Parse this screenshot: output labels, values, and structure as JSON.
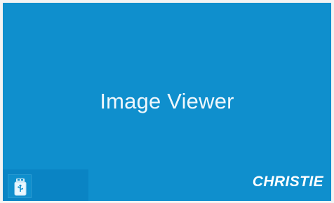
{
  "screen": {
    "title": "Image Viewer"
  },
  "footer": {
    "brand": "CHRISTIE",
    "usb_icon": "usb-drive-icon"
  },
  "colors": {
    "background": "#0f8fcd",
    "panel": "#0a84c4",
    "text": "#eef7fc"
  }
}
